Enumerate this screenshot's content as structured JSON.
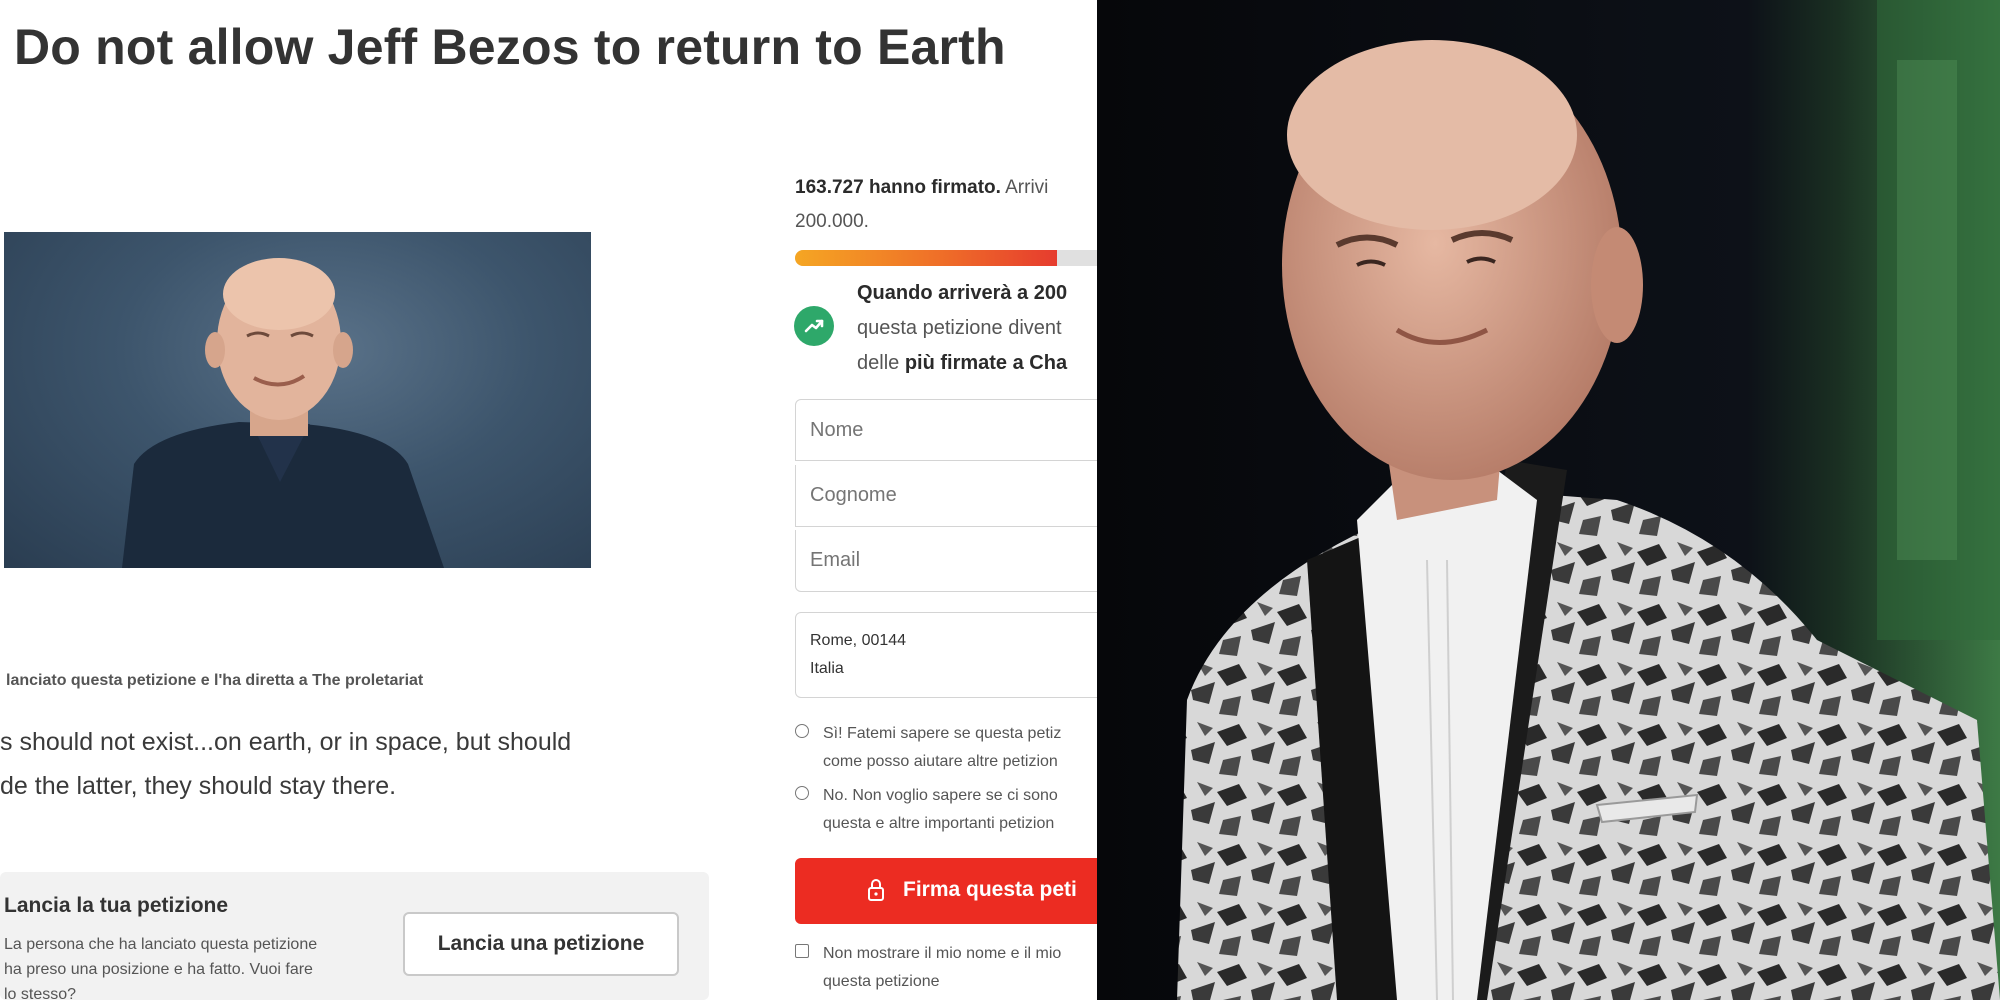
{
  "petition": {
    "title": "Do not allow Jeff Bezos to return to Earth",
    "starter_line": "lanciato questa petizione e l'ha diretta a The proletariat",
    "description_lines": [
      "s should not exist...on earth, or in space, but should",
      "de the latter, they should stay there."
    ]
  },
  "signatures": {
    "count_bold": "163.727 hanno firmato.",
    "count_rest": " Arrivi",
    "goal_line": "200.000.",
    "progress_fraction": 0.82
  },
  "milestone": {
    "line1_bold": "Quando arriverà a 200",
    "line2": "questa petizione divent",
    "line3_prefix": "delle ",
    "line3_bold": "più firmate a Cha"
  },
  "form": {
    "first_name_placeholder": "Nome",
    "last_name_placeholder": "Cognome",
    "email_placeholder": "Email",
    "location_line1": "Rome, 00144",
    "location_line2": "Italia"
  },
  "opt_in": {
    "yes_line1": "Sì! Fatemi sapere se questa petiz",
    "yes_line2": "come posso aiutare altre petizion",
    "no_line1": "No. Non voglio sapere se ci sono",
    "no_line2": "questa e altre importanti petizion"
  },
  "sign_button_label": "Firma questa peti",
  "hide_name": {
    "line1": "Non mostrare il mio nome e il mio",
    "line2": "questa petizione"
  },
  "start_petition": {
    "title": "Lancia la tua petizione",
    "text": "La persona che ha lanciato questa petizione ha preso una posizione e ha fatto. Vuoi fare lo stesso?",
    "button_label": "Lancia una petizione"
  },
  "colors": {
    "sign_button": "#ec2c22",
    "milestone_icon": "#2ea86a",
    "progress_start": "#f5a623",
    "progress_end": "#e63c2e"
  },
  "icons": {
    "milestone": "trending-up-icon",
    "sign": "lock-icon"
  }
}
